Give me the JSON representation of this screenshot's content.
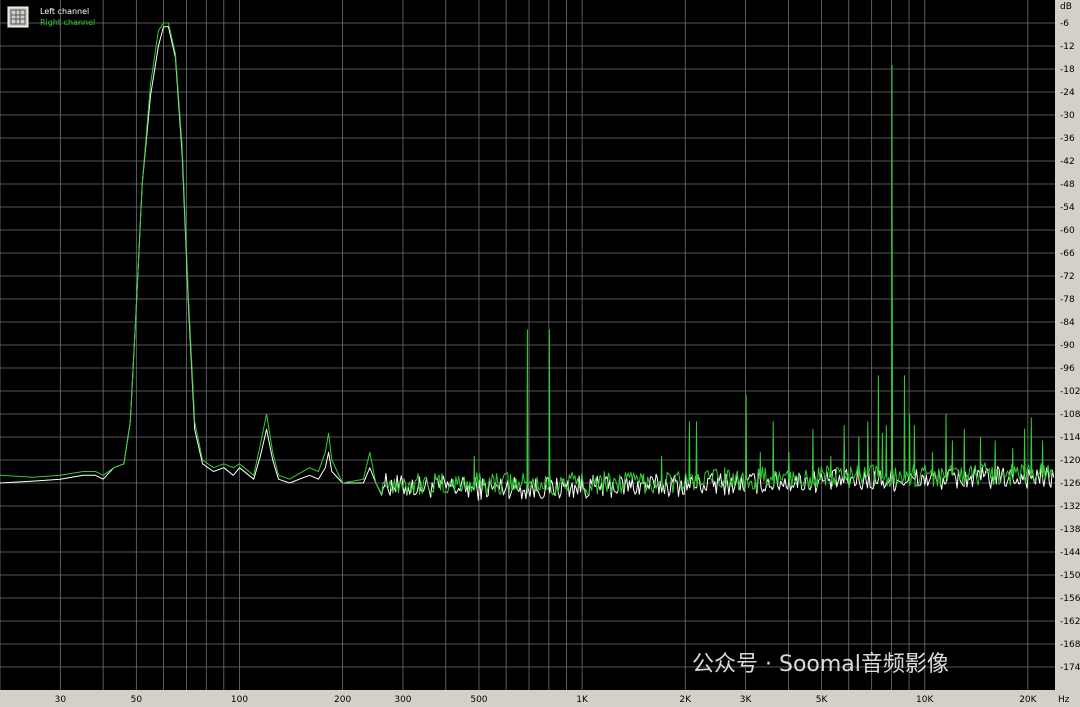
{
  "chart_data": {
    "type": "line",
    "title": "",
    "x_scale": "log",
    "xlim": [
      20,
      24000
    ],
    "ylim": [
      -180,
      0
    ],
    "y_unit_label": "dB",
    "x_unit_label": "Hz",
    "x_ticks": [
      {
        "value": 30,
        "label": "30"
      },
      {
        "value": 50,
        "label": "50"
      },
      {
        "value": 100,
        "label": "100"
      },
      {
        "value": 200,
        "label": "200"
      },
      {
        "value": 300,
        "label": "300"
      },
      {
        "value": 500,
        "label": "500"
      },
      {
        "value": 1000,
        "label": "1K"
      },
      {
        "value": 2000,
        "label": "2K"
      },
      {
        "value": 3000,
        "label": "3K"
      },
      {
        "value": 5000,
        "label": "5K"
      },
      {
        "value": 10000,
        "label": "10K"
      },
      {
        "value": 20000,
        "label": "20K"
      }
    ],
    "y_ticks": [
      -6,
      -12,
      -18,
      -24,
      -30,
      -36,
      -42,
      -48,
      -54,
      -60,
      -66,
      -72,
      -78,
      -84,
      -90,
      -96,
      -102,
      -108,
      -114,
      -120,
      -126,
      -132,
      -138,
      -144,
      -150,
      -156,
      -162,
      -168,
      -174
    ],
    "grid": true,
    "legend_position": "top-left",
    "series": [
      {
        "name": "Left channel",
        "color": "#ffffff",
        "points": [
          [
            20,
            -126
          ],
          [
            25,
            -125.5
          ],
          [
            30,
            -125
          ],
          [
            35,
            -124
          ],
          [
            38,
            -124
          ],
          [
            40,
            -125
          ],
          [
            43,
            -122
          ],
          [
            46,
            -121
          ],
          [
            48,
            -110
          ],
          [
            50,
            -80
          ],
          [
            52,
            -48
          ],
          [
            55,
            -25
          ],
          [
            58,
            -12
          ],
          [
            60,
            -7
          ],
          [
            62,
            -7
          ],
          [
            65,
            -15
          ],
          [
            68,
            -40
          ],
          [
            71,
            -80
          ],
          [
            74,
            -112
          ],
          [
            78,
            -121
          ],
          [
            84,
            -123
          ],
          [
            90,
            -122
          ],
          [
            96,
            -124
          ],
          [
            100,
            -122
          ],
          [
            110,
            -125
          ],
          [
            115,
            -119
          ],
          [
            120,
            -112
          ],
          [
            125,
            -120
          ],
          [
            130,
            -125
          ],
          [
            140,
            -126
          ],
          [
            160,
            -124
          ],
          [
            170,
            -125
          ],
          [
            178,
            -122
          ],
          [
            182,
            -118
          ],
          [
            186,
            -123
          ],
          [
            200,
            -126
          ],
          [
            230,
            -126
          ],
          [
            240,
            -122
          ],
          [
            250,
            -126
          ],
          [
            300,
            -127
          ],
          [
            400,
            -127
          ],
          [
            500,
            -127.5
          ],
          [
            600,
            -127
          ],
          [
            700,
            -127.5
          ],
          [
            1000,
            -127
          ],
          [
            2000,
            -126.5
          ],
          [
            3000,
            -126
          ],
          [
            5000,
            -125.5
          ],
          [
            10000,
            -125
          ],
          [
            20000,
            -124.5
          ],
          [
            24000,
            -125
          ]
        ]
      },
      {
        "name": "Right channel",
        "color": "#33cc33",
        "points": [
          [
            20,
            -124
          ],
          [
            25,
            -124.5
          ],
          [
            30,
            -124
          ],
          [
            35,
            -123
          ],
          [
            38,
            -123
          ],
          [
            40,
            -124
          ],
          [
            43,
            -122
          ],
          [
            46,
            -121
          ],
          [
            48,
            -110
          ],
          [
            50,
            -80
          ],
          [
            52,
            -48
          ],
          [
            55,
            -22
          ],
          [
            58,
            -8
          ],
          [
            60,
            -6
          ],
          [
            62,
            -6
          ],
          [
            65,
            -14
          ],
          [
            68,
            -38
          ],
          [
            71,
            -78
          ],
          [
            74,
            -110
          ],
          [
            78,
            -120
          ],
          [
            84,
            -122
          ],
          [
            90,
            -121
          ],
          [
            96,
            -122
          ],
          [
            100,
            -121
          ],
          [
            110,
            -124
          ],
          [
            115,
            -116
          ],
          [
            120,
            -108
          ],
          [
            125,
            -118
          ],
          [
            130,
            -124
          ],
          [
            140,
            -125
          ],
          [
            160,
            -122
          ],
          [
            170,
            -123
          ],
          [
            178,
            -118
          ],
          [
            182,
            -113
          ],
          [
            186,
            -120
          ],
          [
            200,
            -126
          ],
          [
            230,
            -125
          ],
          [
            240,
            -118
          ],
          [
            250,
            -126
          ],
          [
            300,
            -126
          ],
          [
            400,
            -126.5
          ],
          [
            500,
            -126
          ],
          [
            600,
            -126
          ],
          [
            700,
            -126.5
          ],
          [
            1000,
            -126
          ],
          [
            2000,
            -125.5
          ],
          [
            3000,
            -125
          ],
          [
            5000,
            -124.5
          ],
          [
            10000,
            -124
          ],
          [
            20000,
            -123.5
          ],
          [
            24000,
            -124
          ]
        ],
        "spikes": [
          [
            483,
            -119
          ],
          [
            690,
            -86
          ],
          [
            800,
            -86
          ],
          [
            1500,
            -124
          ],
          [
            1700,
            -119
          ],
          [
            2050,
            -110
          ],
          [
            2150,
            -110
          ],
          [
            2600,
            -122
          ],
          [
            3000,
            -103
          ],
          [
            3300,
            -118
          ],
          [
            3600,
            -110
          ],
          [
            4000,
            -118
          ],
          [
            4700,
            -112
          ],
          [
            5300,
            -119
          ],
          [
            5800,
            -111
          ],
          [
            6400,
            -114
          ],
          [
            6800,
            -110
          ],
          [
            7300,
            -98
          ],
          [
            7500,
            -113
          ],
          [
            7700,
            -111
          ],
          [
            8000,
            -17
          ],
          [
            8700,
            -98
          ],
          [
            9000,
            -108
          ],
          [
            9300,
            -111
          ],
          [
            10500,
            -118
          ],
          [
            11500,
            -108
          ],
          [
            12000,
            -115
          ],
          [
            13000,
            -112
          ],
          [
            14500,
            -114
          ],
          [
            16000,
            -115
          ],
          [
            18000,
            -117
          ],
          [
            19500,
            -112
          ],
          [
            20400,
            -109
          ],
          [
            22000,
            -115
          ]
        ]
      }
    ],
    "watermark": "公众号 · Soomal音频影像"
  }
}
